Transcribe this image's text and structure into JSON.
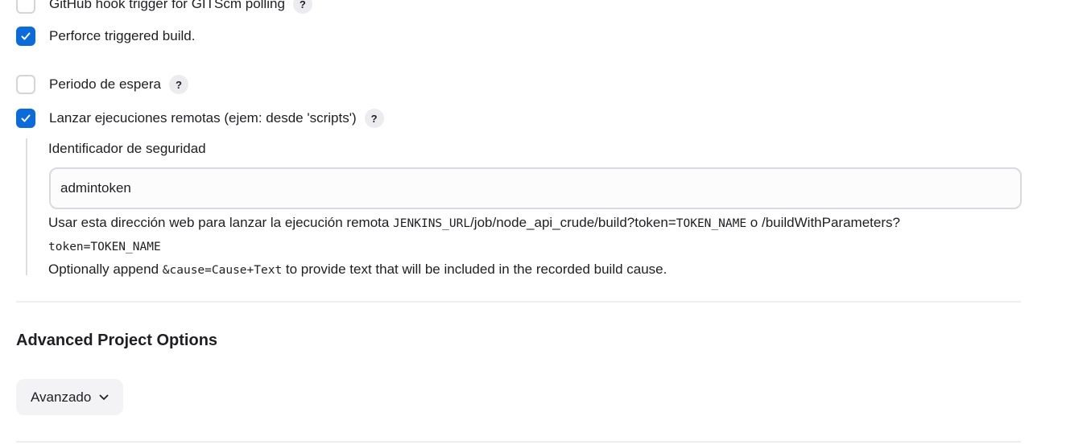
{
  "triggers": {
    "github_hook": {
      "label": "GitHub hook trigger for GITScm polling",
      "checked": false,
      "help": "?"
    },
    "perforce": {
      "label": "Perforce triggered build.",
      "checked": true
    },
    "quiet_period": {
      "label": "Periodo de espera",
      "checked": false,
      "help": "?"
    },
    "remote": {
      "label": "Lanzar ejecuciones remotas (ejem: desde 'scripts')",
      "checked": true,
      "help": "?"
    }
  },
  "remote_config": {
    "token_label": "Identificador de seguridad",
    "token_value": "admintoken",
    "help_line1_prefix": "Usar esta dirección web para lanzar la ejecución remota ",
    "help_jenkins_url": "JENKINS_URL",
    "help_path1": "/job/node_api_crude/build?token=",
    "help_token_name_1": "TOKEN_NAME",
    "help_or": " o /buildWithParameters?",
    "help_token_eq": "token=",
    "help_token_name_2": "TOKEN_NAME",
    "help_line3_prefix": "Optionally append ",
    "help_cause": "&cause=Cause+Text",
    "help_line3_suffix": " to provide text that will be included in the recorded build cause."
  },
  "advanced": {
    "section_title": "Advanced Project Options",
    "button_label": "Avanzado",
    "button_icon": "chevron-down-icon"
  },
  "colors": {
    "accent": "#0b6bdb",
    "checkbox_border": "#d4d4da",
    "help_bg": "#ececf0",
    "button_bg": "#f3f3f6",
    "text": "#1f1f23"
  }
}
